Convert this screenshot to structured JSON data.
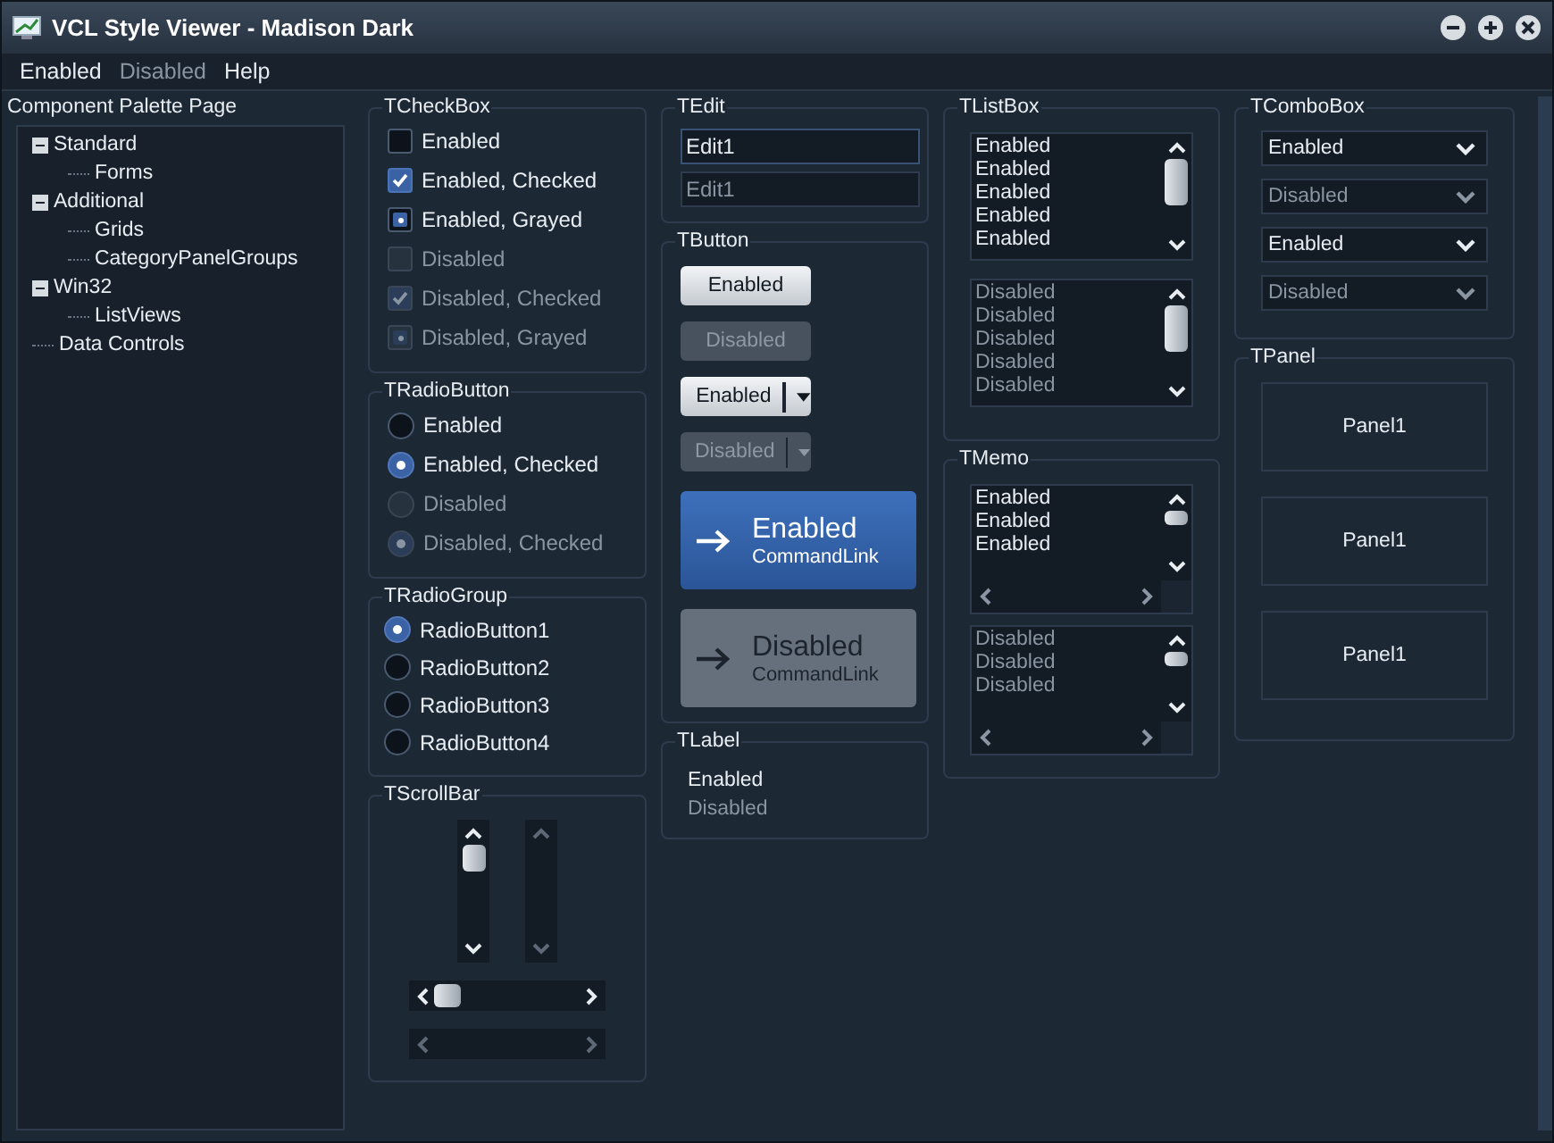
{
  "window": {
    "title": "VCL Style Viewer - Madison Dark"
  },
  "menu": [
    {
      "label": "Enabled",
      "disabled": false
    },
    {
      "label": "Disabled",
      "disabled": true
    },
    {
      "label": "Help",
      "disabled": false
    }
  ],
  "sidebar": {
    "title": "Component Palette Page",
    "tree": [
      {
        "label": "Standard",
        "expanded": true,
        "children": [
          {
            "label": "Forms"
          }
        ]
      },
      {
        "label": "Additional",
        "expanded": true,
        "children": [
          {
            "label": "Grids"
          },
          {
            "label": "CategoryPanelGroups"
          }
        ]
      },
      {
        "label": "Win32",
        "expanded": true,
        "children": [
          {
            "label": "ListViews"
          }
        ]
      },
      {
        "label": "Data Controls"
      }
    ]
  },
  "checkbox_group": {
    "title": "TCheckBox",
    "items": [
      {
        "label": "Enabled",
        "checked": false,
        "grayed": false,
        "disabled": false
      },
      {
        "label": "Enabled, Checked",
        "checked": true,
        "grayed": false,
        "disabled": false
      },
      {
        "label": "Enabled, Grayed",
        "checked": false,
        "grayed": true,
        "disabled": false
      },
      {
        "label": "Disabled",
        "checked": false,
        "grayed": false,
        "disabled": true
      },
      {
        "label": "Disabled, Checked",
        "checked": true,
        "grayed": false,
        "disabled": true
      },
      {
        "label": "Disabled, Grayed",
        "checked": false,
        "grayed": true,
        "disabled": true
      }
    ]
  },
  "radio_button_group": {
    "title": "TRadioButton",
    "items": [
      {
        "label": "Enabled",
        "selected": false,
        "disabled": false
      },
      {
        "label": "Enabled, Checked",
        "selected": true,
        "disabled": false
      },
      {
        "label": "Disabled",
        "selected": false,
        "disabled": true
      },
      {
        "label": "Disabled, Checked",
        "selected": true,
        "disabled": true
      }
    ]
  },
  "radio_group": {
    "title": "TRadioGroup",
    "items": [
      {
        "label": "RadioButton1",
        "selected": true
      },
      {
        "label": "RadioButton2",
        "selected": false
      },
      {
        "label": "RadioButton3",
        "selected": false
      },
      {
        "label": "RadioButton4",
        "selected": false
      }
    ]
  },
  "scrollbar_group": {
    "title": "TScrollBar",
    "bars": [
      {
        "kind": "vertical",
        "disabled": false
      },
      {
        "kind": "vertical",
        "disabled": true
      },
      {
        "kind": "horizontal",
        "disabled": false
      },
      {
        "kind": "horizontal",
        "disabled": true
      }
    ]
  },
  "edit_group": {
    "title": "TEdit",
    "fields": [
      {
        "value": "Edit1",
        "disabled": false
      },
      {
        "value": "Edit1",
        "disabled": true
      }
    ]
  },
  "button_group": {
    "title": "TButton",
    "buttons": [
      {
        "kind": "push",
        "label": "Enabled",
        "disabled": false
      },
      {
        "kind": "push",
        "label": "Disabled",
        "disabled": true
      },
      {
        "kind": "split",
        "label": "Enabled",
        "disabled": false
      },
      {
        "kind": "split",
        "label": "Disabled",
        "disabled": true
      },
      {
        "kind": "command_link",
        "label": "Enabled",
        "note": "CommandLink",
        "disabled": false
      },
      {
        "kind": "command_link",
        "label": "Disabled",
        "note": "CommandLink",
        "disabled": true
      }
    ]
  },
  "label_group": {
    "title": "TLabel",
    "labels": [
      {
        "text": "Enabled",
        "disabled": false
      },
      {
        "text": "Disabled",
        "disabled": true
      }
    ]
  },
  "listbox_group": {
    "title": "TListBox",
    "lists": [
      {
        "disabled": false,
        "items": [
          "Enabled",
          "Enabled",
          "Enabled",
          "Enabled",
          "Enabled"
        ]
      },
      {
        "disabled": true,
        "items": [
          "Disabled",
          "Disabled",
          "Disabled",
          "Disabled",
          "Disabled"
        ]
      }
    ]
  },
  "memo_group": {
    "title": "TMemo",
    "memos": [
      {
        "disabled": false,
        "lines": [
          "Enabled",
          "Enabled",
          "Enabled"
        ]
      },
      {
        "disabled": true,
        "lines": [
          "Disabled",
          "Disabled",
          "Disabled"
        ]
      }
    ]
  },
  "combobox_group": {
    "title": "TComboBox",
    "boxes": [
      {
        "value": "Enabled",
        "disabled": false
      },
      {
        "value": "Disabled",
        "disabled": true
      },
      {
        "value": "Enabled",
        "disabled": false
      },
      {
        "value": "Disabled",
        "disabled": true
      }
    ]
  },
  "panel_group": {
    "title": "TPanel",
    "panels": [
      "Panel1",
      "Panel1",
      "Panel1"
    ]
  }
}
